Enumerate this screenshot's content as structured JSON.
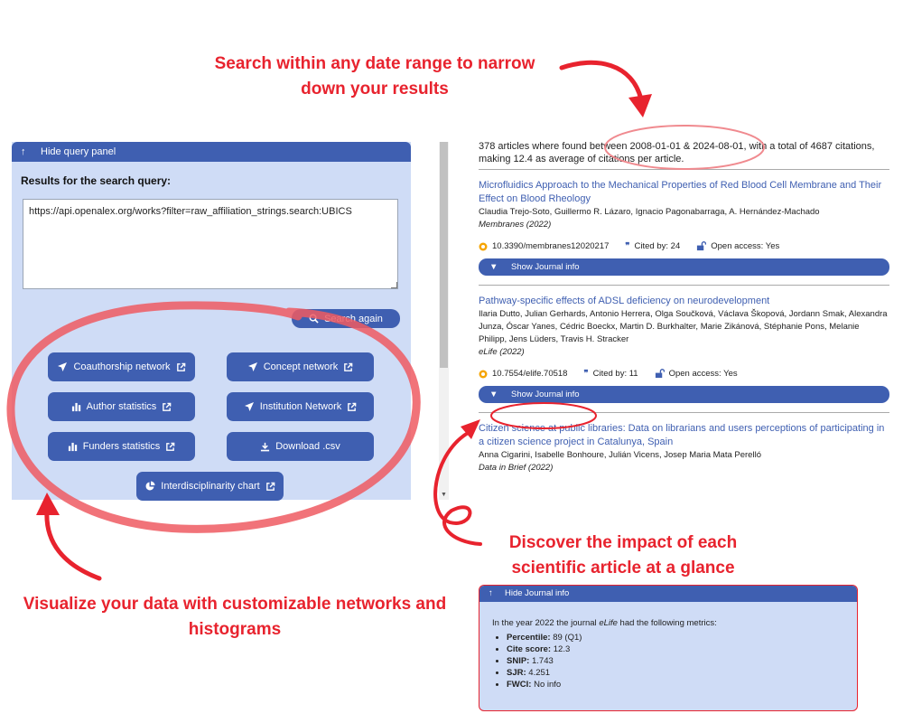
{
  "callouts": {
    "top_line1": "Search within any date range to narrow",
    "top_line2": "down your results",
    "mid_line1": "Discover the impact of each",
    "mid_line2": "scientific article at a glance",
    "left_line1": "Visualize your data with customizable networks and",
    "left_line2": "histograms"
  },
  "query_panel": {
    "header": "Hide query panel",
    "results_label": "Results for the search query:",
    "query_value": "https://api.openalex.org/works?filter=raw_affiliation_strings.search:UBICS",
    "search_button": "Search again",
    "buttons": {
      "coauthorship": "Coauthorship network",
      "concept": "Concept network",
      "author_stats": "Author statistics",
      "institution": "Institution Network",
      "funders": "Funders statistics",
      "download": "Download .csv",
      "interdisciplinarity": "Interdisciplinarity chart"
    }
  },
  "results": {
    "summary": "378 articles where found between 2008-01-01 & 2024-08-01, with a total of 4687 citations, making 12.4 as average of citations per article.",
    "articles": [
      {
        "title": "Microfluidics Approach to the Mechanical Properties of Red Blood Cell Membrane and Their Effect on Blood Rheology",
        "authors": "Claudia Trejo-Soto, Guillermo R. Lázaro, Ignacio Pagonabarraga, A. Hernández-Machado",
        "journal": "Membranes (2022)",
        "doi": "10.3390/membranes12020217",
        "cited": "Cited by: 24",
        "open_access": "Open access: Yes",
        "journal_button": "Show Journal info"
      },
      {
        "title": "Pathway-specific effects of ADSL deficiency on neurodevelopment",
        "authors": "Ilaria Dutto, Julian Gerhards, Antonio Herrera, Olga Součková, Václava Škopová, Jordann Smak, Alexandra Junza, Óscar Yanes, Cédric Boeckx, Martin D. Burkhalter, Marie Zikánová, Stéphanie Pons, Melanie Philipp, Jens Lüders, Travis H. Stracker",
        "journal": "eLife (2022)",
        "doi": "10.7554/elife.70518",
        "cited": "Cited by: 11",
        "open_access": "Open access: Yes",
        "journal_button": "Show Journal info"
      },
      {
        "title": "Citizen science at public libraries: Data on librarians and users perceptions of participating in a citizen science project in Catalunya, Spain",
        "authors": "Anna Cigarini, Isabelle Bonhoure, Julián Vicens, Josep Maria Mata Perelló",
        "journal": "Data in Brief (2022)"
      }
    ]
  },
  "journal_card": {
    "header": "Hide Journal info",
    "intro_prefix": "In the year 2022 the journal ",
    "intro_journal": "eLife",
    "intro_suffix": " had the following metrics:",
    "metrics": [
      {
        "label": "Percentile:",
        "value": " 89 (Q1)"
      },
      {
        "label": "Cite score:",
        "value": " 12.3"
      },
      {
        "label": "SNIP:",
        "value": " 1.743"
      },
      {
        "label": "SJR:",
        "value": " 4.251"
      },
      {
        "label": "FWCI:",
        "value": " No info"
      }
    ]
  },
  "colors": {
    "accent": "#3f5fb1",
    "panel": "#cfdcf6",
    "annotation": "#e8232e"
  }
}
